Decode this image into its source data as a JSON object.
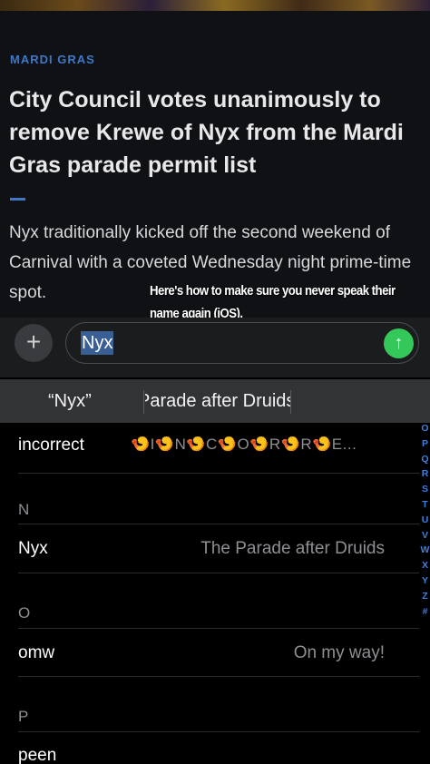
{
  "article": {
    "section": "MARDI GRAS",
    "headline": "City Council votes unanimously to remove Krewe of Nyx from the Mardi Gras parade permit list",
    "lede": "Nyx traditionally kicked off the second weekend of Carnival with a coveted Wednesday night prime-time spot."
  },
  "overlay_caption": "Here's how to make sure you never speak their name again (iOS).",
  "compose": {
    "add_icon": "plus-icon",
    "field_value": "Nyx",
    "send_icon": "arrow-up-icon",
    "send_color": "#34c759"
  },
  "suggestions": [
    "“Nyx”",
    "Parade after Druids"
  ],
  "replacements": [
    {
      "type": "row",
      "shortcut": "incorrect",
      "emoji_phrase": [
        "🍤",
        "I",
        "🍤",
        "N",
        "🍤",
        "C",
        "🍤",
        "O",
        "🍤",
        "R",
        "🍤",
        "R",
        "🍤",
        "E..."
      ]
    },
    {
      "type": "header",
      "letter": "N"
    },
    {
      "type": "row",
      "shortcut": "Nyx",
      "phrase": "The Parade after Druids"
    },
    {
      "type": "header",
      "letter": "O"
    },
    {
      "type": "row",
      "shortcut": "omw",
      "phrase": "On my way!"
    },
    {
      "type": "header",
      "letter": "P"
    },
    {
      "type": "row",
      "shortcut": "peen",
      "phrase": ""
    }
  ],
  "section_index": [
    "O",
    "P",
    "Q",
    "R",
    "S",
    "T",
    "U",
    "V",
    "W",
    "X",
    "Y",
    "Z",
    "#"
  ],
  "colors": {
    "accent": "#3f78c7",
    "index": "#3f7fe0"
  }
}
